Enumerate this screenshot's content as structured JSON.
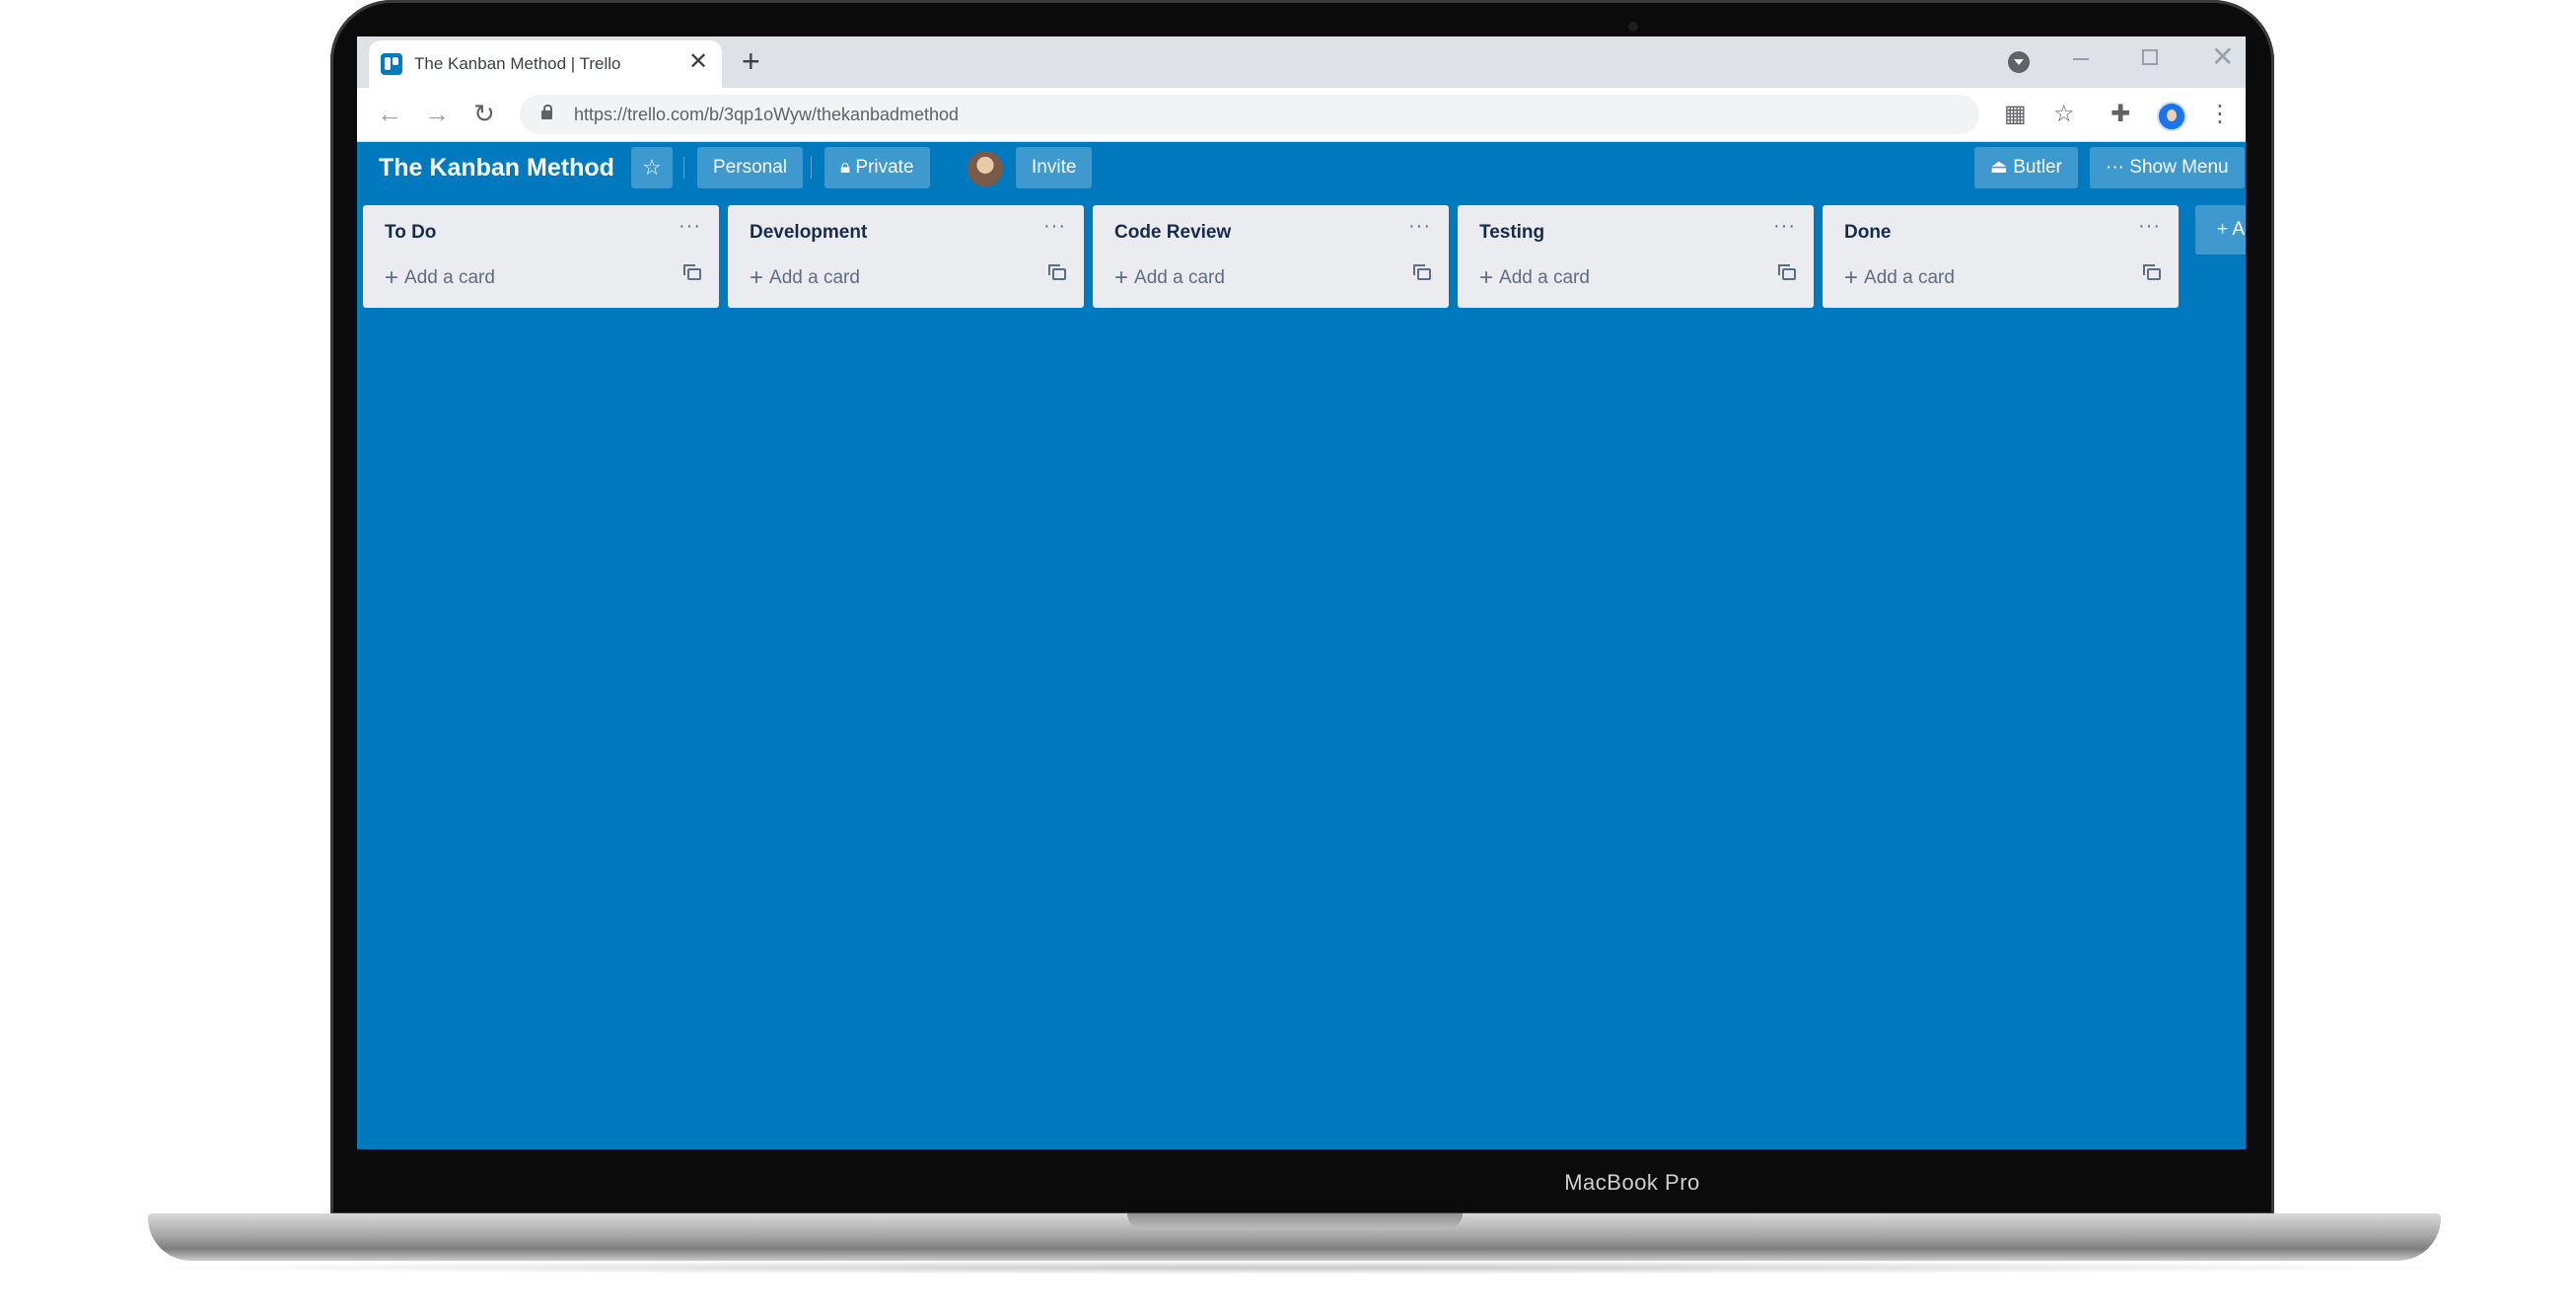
{
  "device": {
    "label": "MacBook Pro"
  },
  "browser": {
    "tab_title": "The Kanban Method | Trello",
    "url": "https://trello.com/b/3qp1oWyw/thekanbadmethod",
    "icons": [
      "trello-favicon",
      "close-icon",
      "plus-icon",
      "profile-dropdown-icon",
      "minimize-icon",
      "restore-icon",
      "window-close-icon",
      "back-icon",
      "forward-icon",
      "reload-icon",
      "lock-icon",
      "qr-code-icon",
      "star-icon",
      "extensions-icon",
      "avatar-icon",
      "menu-icon"
    ]
  },
  "board": {
    "title": "The Kanban Method",
    "personal_label": "Personal",
    "private_label": "Private",
    "invite_label": "Invite",
    "butler_label": "Butler",
    "show_menu_label": "Show Menu",
    "add_list_label": "+ Ad",
    "background_color": "#0079bf",
    "lists": [
      {
        "name": "To Do",
        "add_card_label": "Add a card"
      },
      {
        "name": "Development",
        "add_card_label": "Add a card"
      },
      {
        "name": "Code Review",
        "add_card_label": "Add a card"
      },
      {
        "name": "Testing",
        "add_card_label": "Add a card"
      },
      {
        "name": "Done",
        "add_card_label": "Add a card"
      }
    ]
  }
}
